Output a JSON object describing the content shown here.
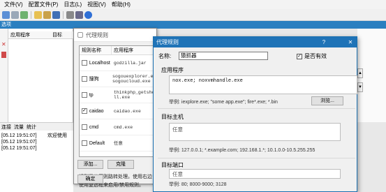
{
  "menu": [
    "文件(V)",
    "配置文件(P)",
    "日志(L)",
    "视图(V)",
    "帮助(H)"
  ],
  "toolbar_icons": [
    "open-icon",
    "copy-icon",
    "image-icon",
    "folder-icon",
    "import-icon",
    "save-icon",
    "gear-icon",
    "print-icon",
    "help-icon"
  ],
  "window_title": "选项",
  "list": {
    "col1": "应用程序",
    "col2": "目标"
  },
  "bottom_tabs": [
    "连接",
    "流量",
    "统计"
  ],
  "log": [
    {
      "time": "[05.12 19:51:07]",
      "msg": "欢迎使用"
    },
    {
      "time": "[05.12 19:51:07]",
      "msg": ""
    },
    {
      "time": "[05.12 19:51:07]",
      "msg": ""
    }
  ],
  "rules_dialog": {
    "title": "代理规则",
    "col_name": "规则名称",
    "col_app": "应用程序",
    "rules": [
      {
        "checked": false,
        "name": "Localhost",
        "app": "godzilla.jar"
      },
      {
        "checked": false,
        "name": "搜狗",
        "app": "sogouexplorer.exe; sogoucloud.exe"
      },
      {
        "checked": false,
        "name": "tp",
        "app": "thinkphp_getshe ll.exe"
      },
      {
        "checked": true,
        "name": "caidao",
        "app": "caidao.exe"
      },
      {
        "checked": false,
        "name": "cmd",
        "app": "cmd.exe"
      },
      {
        "checked": false,
        "name": "Default",
        "app": "任意"
      }
    ],
    "add_label": "添加...",
    "clone_label": "克隆",
    "desc_line1": "规则是从原则路转处理。使用右边",
    "desc_line2": "使用复选框来启用/禁用规则。",
    "ok_label": "确定"
  },
  "rule_editor": {
    "title": "代理规则",
    "help": "?",
    "close": "✕",
    "name_label": "名称:",
    "name_value": "猿抓器",
    "enabled_label": "是否有效",
    "enabled": true,
    "apps_label": "应用程序",
    "apps_value": "nox.exe; noxvmhandle.exe",
    "apps_example": "举例: iexplore.exe; \"some app.exe\"; fire*.exe; *.bin",
    "browse_label": "浏览...",
    "hosts_label": "目标主机",
    "hosts_value": "任意",
    "hosts_example": "举例: 127.0.0.1; *.example.com; 192.168.1.*; 10.1.0.0-10.5.255.255",
    "ports_label": "目标端口",
    "ports_value": "任意",
    "ports_example": "举例: 80; 8000-9000; 3128"
  },
  "colors": {
    "accent": "#1f73b7",
    "title_strip": "#2a7fc0"
  }
}
